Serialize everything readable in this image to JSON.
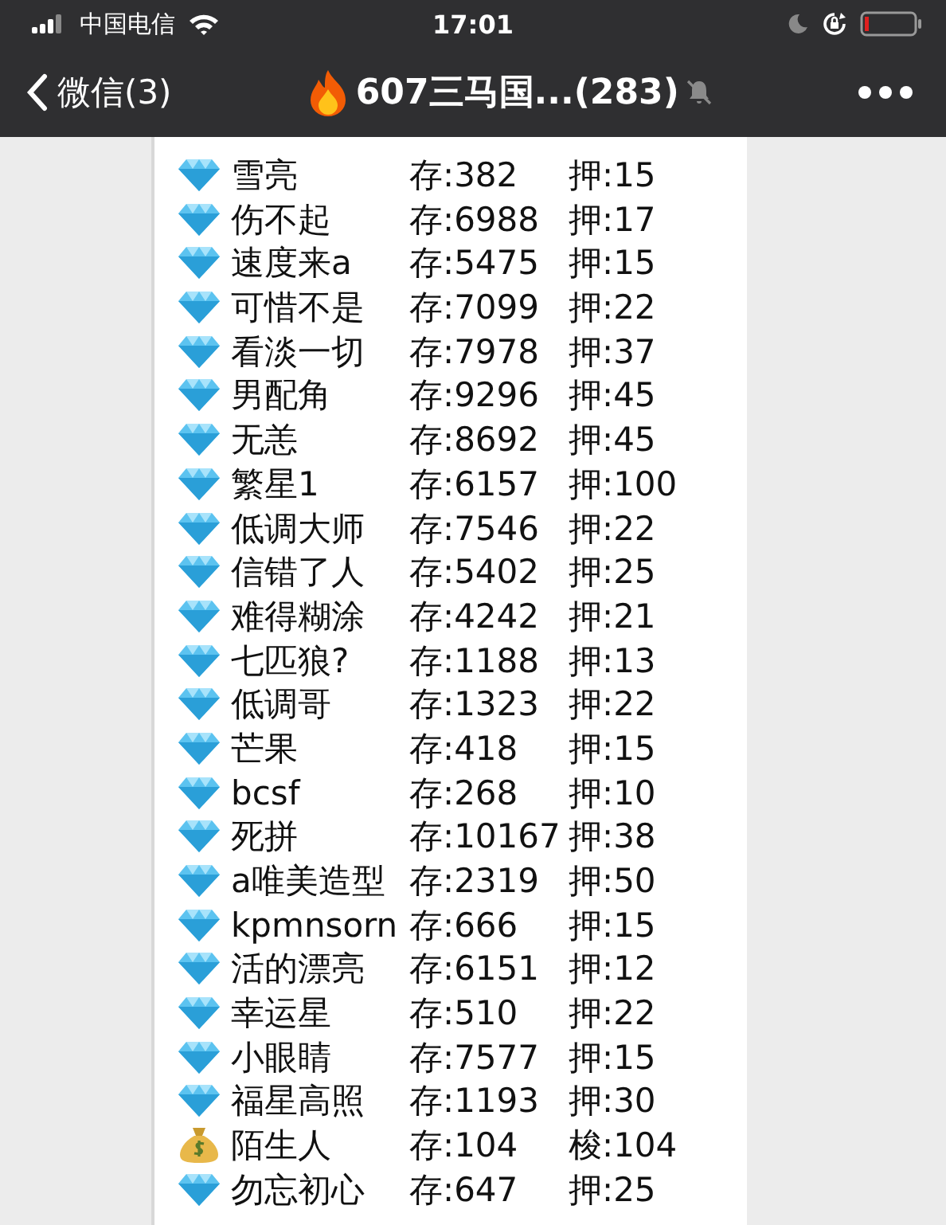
{
  "status_bar": {
    "carrier": "中国电信",
    "time": "17:01"
  },
  "nav_bar": {
    "back_label": "微信(3)",
    "title": "607三马国...(283)",
    "muted": true
  },
  "message": {
    "rows": [
      {
        "kind": "diamond",
        "name": "雪亮",
        "deposit": "存:382",
        "stake": "押:15"
      },
      {
        "kind": "diamond",
        "name": "伤不起",
        "deposit": "存:6988",
        "stake": "押:17"
      },
      {
        "kind": "diamond",
        "name": "速度来a",
        "deposit": "存:5475",
        "stake": "押:15"
      },
      {
        "kind": "diamond",
        "name": "可惜不是",
        "deposit": "存:7099",
        "stake": "押:22"
      },
      {
        "kind": "diamond",
        "name": "看淡一切",
        "deposit": "存:7978",
        "stake": "押:37"
      },
      {
        "kind": "diamond",
        "name": "男配角",
        "deposit": "存:9296",
        "stake": "押:45"
      },
      {
        "kind": "diamond",
        "name": "无恙",
        "deposit": "存:8692",
        "stake": "押:45"
      },
      {
        "kind": "diamond",
        "name": "繁星1",
        "deposit": "存:6157",
        "stake": "押:100"
      },
      {
        "kind": "diamond",
        "name": "低调大师",
        "deposit": "存:7546",
        "stake": "押:22"
      },
      {
        "kind": "diamond",
        "name": "信错了人",
        "deposit": "存:5402",
        "stake": "押:25"
      },
      {
        "kind": "diamond",
        "name": "难得糊涂",
        "deposit": "存:4242",
        "stake": "押:21"
      },
      {
        "kind": "diamond",
        "name": "七匹狼?",
        "deposit": "存:1188",
        "stake": "押:13"
      },
      {
        "kind": "diamond",
        "name": "低调哥",
        "deposit": "存:1323",
        "stake": "押:22"
      },
      {
        "kind": "diamond",
        "name": "芒果",
        "deposit": "存:418",
        "stake": "押:15"
      },
      {
        "kind": "diamond",
        "name": "bcsf",
        "deposit": "存:268",
        "stake": "押:10"
      },
      {
        "kind": "diamond",
        "name": "死拼",
        "deposit": "存:10167",
        "stake": "押:38"
      },
      {
        "kind": "diamond",
        "name": "a唯美造型",
        "deposit": "存:2319",
        "stake": "押:50"
      },
      {
        "kind": "diamond",
        "name": "kpmnsorn",
        "deposit": "存:666",
        "stake": "押:15"
      },
      {
        "kind": "diamond",
        "name": "活的漂亮",
        "deposit": "存:6151",
        "stake": "押:12"
      },
      {
        "kind": "diamond",
        "name": "幸运星",
        "deposit": "存:510",
        "stake": "押:22"
      },
      {
        "kind": "diamond",
        "name": "小眼睛",
        "deposit": "存:7577",
        "stake": "押:15"
      },
      {
        "kind": "diamond",
        "name": "福星高照",
        "deposit": "存:1193",
        "stake": "押:30"
      },
      {
        "kind": "moneybag",
        "name": "陌生人",
        "deposit": "存:104",
        "stake": "梭:104"
      },
      {
        "kind": "diamond",
        "name": "勿忘初心",
        "deposit": "存:647",
        "stake": "押:25"
      }
    ]
  }
}
